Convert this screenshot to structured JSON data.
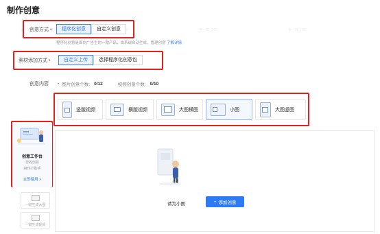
{
  "page": {
    "title": "制作创意"
  },
  "creative_mode": {
    "label": "创意方式",
    "options": [
      {
        "label": "程序化创意",
        "active": true
      },
      {
        "label": "自定义创意",
        "active": false
      }
    ],
    "hint": "程序化创意是面向广告主的一款产品，由系统自动生成、管理创意",
    "hint_link": "了解详情"
  },
  "material_mode": {
    "label": "素材添加方式",
    "options": [
      {
        "label": "自定义上传",
        "active": true
      },
      {
        "label": "选择程序化创意包",
        "active": false
      }
    ]
  },
  "content": {
    "label": "创意内容",
    "image_count_label": "图片创意个数:",
    "image_count_value": "0/12",
    "video_count_label": "视频创意个数:",
    "video_count_value": "0/10"
  },
  "formats": [
    {
      "label": "竖版视频",
      "icon": "vertical-video-icon"
    },
    {
      "label": "横版视频",
      "icon": "horizontal-video-icon"
    },
    {
      "label": "大图横图",
      "icon": "large-horizontal-image-icon"
    },
    {
      "label": "小图",
      "icon": "small-image-icon",
      "selected": true
    },
    {
      "label": "大图竖图",
      "icon": "large-vertical-image-icon"
    }
  ],
  "workbench": {
    "title": "创意工作台",
    "desc_line1": "您的创意",
    "desc_line2": "制作小助手",
    "link": "立即使用 >"
  },
  "side_tools": [
    {
      "label": "一键生成大图"
    },
    {
      "label": "一键生成视频"
    }
  ],
  "empty_state": {
    "text": "请为小图",
    "button_label": "添加创意",
    "button_icon": "plus-icon"
  },
  "watermark": "美一数_D60",
  "colors": {
    "accent": "#2d7bf3",
    "highlight": "#e0211c"
  }
}
